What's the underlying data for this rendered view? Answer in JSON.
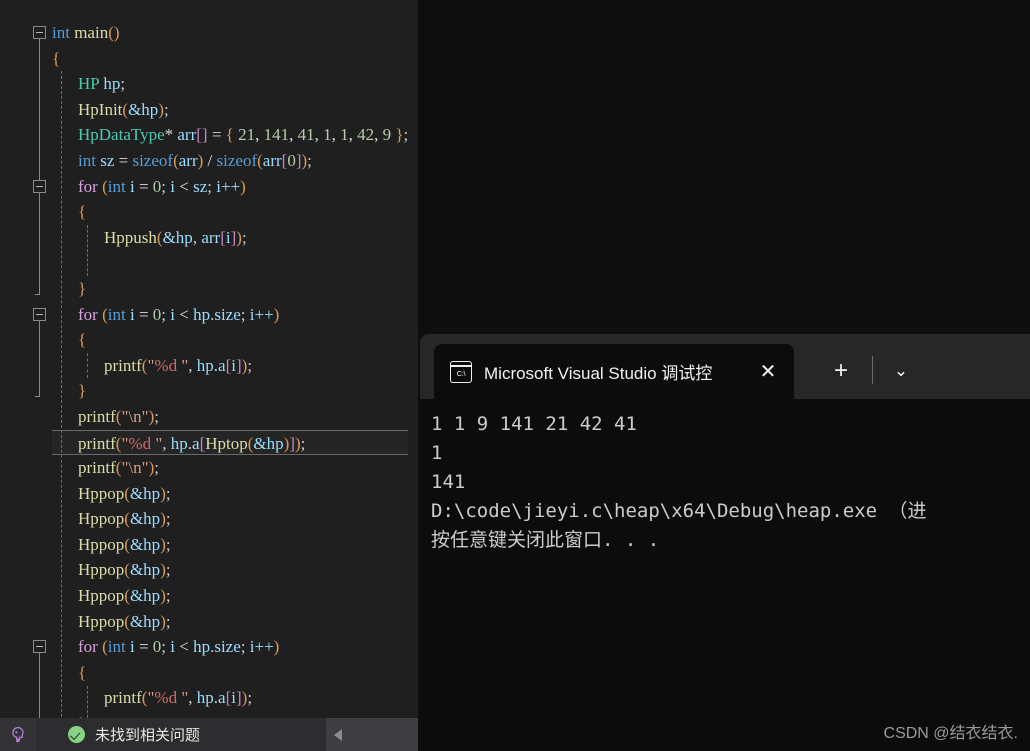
{
  "editor": {
    "name": "visual-studio-code-editor",
    "language": "C",
    "lines": [
      {
        "indent": 0,
        "tokens": [
          {
            "t": "int",
            "c": "tk-kw"
          },
          {
            "t": " ",
            "c": "tk-plain"
          },
          {
            "t": "main",
            "c": "tk-fn"
          },
          {
            "t": "()",
            "c": "tk-brace"
          }
        ]
      },
      {
        "indent": 0,
        "tokens": [
          {
            "t": "{",
            "c": "tk-brace"
          }
        ]
      },
      {
        "indent": 1,
        "tokens": [
          {
            "t": "HP",
            "c": "tk-type"
          },
          {
            "t": " ",
            "c": "tk-plain"
          },
          {
            "t": "hp",
            "c": "tk-var"
          },
          {
            "t": ";",
            "c": "tk-punc"
          }
        ]
      },
      {
        "indent": 1,
        "tokens": [
          {
            "t": "HpInit",
            "c": "tk-fn"
          },
          {
            "t": "(",
            "c": "tk-brace"
          },
          {
            "t": "&hp",
            "c": "tk-var"
          },
          {
            "t": ")",
            "c": "tk-brace"
          },
          {
            "t": ";",
            "c": "tk-punc"
          }
        ]
      },
      {
        "indent": 1,
        "tokens": [
          {
            "t": "HpDataType",
            "c": "tk-type"
          },
          {
            "t": "* ",
            "c": "tk-plain"
          },
          {
            "t": "arr",
            "c": "tk-var"
          },
          {
            "t": "[]",
            "c": "tk-brkt"
          },
          {
            "t": " = ",
            "c": "tk-plain"
          },
          {
            "t": "{",
            "c": "tk-brace"
          },
          {
            "t": " ",
            "c": "tk-plain"
          },
          {
            "t": "21",
            "c": "tk-num"
          },
          {
            "t": ", ",
            "c": "tk-plain"
          },
          {
            "t": "141",
            "c": "tk-num"
          },
          {
            "t": ", ",
            "c": "tk-plain"
          },
          {
            "t": "41",
            "c": "tk-num"
          },
          {
            "t": ", ",
            "c": "tk-plain"
          },
          {
            "t": "1",
            "c": "tk-num"
          },
          {
            "t": ", ",
            "c": "tk-plain"
          },
          {
            "t": "1",
            "c": "tk-num"
          },
          {
            "t": ", ",
            "c": "tk-plain"
          },
          {
            "t": "42",
            "c": "tk-num"
          },
          {
            "t": ", ",
            "c": "tk-plain"
          },
          {
            "t": "9",
            "c": "tk-num"
          },
          {
            "t": " ",
            "c": "tk-plain"
          },
          {
            "t": "}",
            "c": "tk-brace"
          },
          {
            "t": ";",
            "c": "tk-punc"
          }
        ]
      },
      {
        "indent": 1,
        "tokens": [
          {
            "t": "int",
            "c": "tk-kw"
          },
          {
            "t": " ",
            "c": "tk-plain"
          },
          {
            "t": "sz",
            "c": "tk-var"
          },
          {
            "t": " = ",
            "c": "tk-plain"
          },
          {
            "t": "sizeof",
            "c": "tk-kw"
          },
          {
            "t": "(",
            "c": "tk-brace"
          },
          {
            "t": "arr",
            "c": "tk-var"
          },
          {
            "t": ")",
            "c": "tk-brace"
          },
          {
            "t": " / ",
            "c": "tk-plain"
          },
          {
            "t": "sizeof",
            "c": "tk-kw"
          },
          {
            "t": "(",
            "c": "tk-brace"
          },
          {
            "t": "arr",
            "c": "tk-var"
          },
          {
            "t": "[",
            "c": "tk-brkt"
          },
          {
            "t": "0",
            "c": "tk-num"
          },
          {
            "t": "]",
            "c": "tk-brkt"
          },
          {
            "t": ")",
            "c": "tk-brace"
          },
          {
            "t": ";",
            "c": "tk-punc"
          }
        ]
      },
      {
        "indent": 1,
        "tokens": [
          {
            "t": "for",
            "c": "tk-ctl"
          },
          {
            "t": " ",
            "c": "tk-plain"
          },
          {
            "t": "(",
            "c": "tk-brace"
          },
          {
            "t": "int",
            "c": "tk-kw"
          },
          {
            "t": " ",
            "c": "tk-plain"
          },
          {
            "t": "i",
            "c": "tk-var"
          },
          {
            "t": " = ",
            "c": "tk-plain"
          },
          {
            "t": "0",
            "c": "tk-num"
          },
          {
            "t": "; ",
            "c": "tk-punc"
          },
          {
            "t": "i",
            "c": "tk-var"
          },
          {
            "t": " < ",
            "c": "tk-plain"
          },
          {
            "t": "sz",
            "c": "tk-var"
          },
          {
            "t": "; ",
            "c": "tk-punc"
          },
          {
            "t": "i++",
            "c": "tk-var"
          },
          {
            "t": ")",
            "c": "tk-brace"
          }
        ]
      },
      {
        "indent": 1,
        "tokens": [
          {
            "t": "{",
            "c": "tk-brace"
          }
        ]
      },
      {
        "indent": 2,
        "tokens": [
          {
            "t": "Hppush",
            "c": "tk-fn"
          },
          {
            "t": "(",
            "c": "tk-brace"
          },
          {
            "t": "&hp",
            "c": "tk-var"
          },
          {
            "t": ", ",
            "c": "tk-punc"
          },
          {
            "t": "arr",
            "c": "tk-var"
          },
          {
            "t": "[",
            "c": "tk-brkt"
          },
          {
            "t": "i",
            "c": "tk-var"
          },
          {
            "t": "]",
            "c": "tk-brkt"
          },
          {
            "t": ")",
            "c": "tk-brace"
          },
          {
            "t": ";",
            "c": "tk-punc"
          }
        ]
      },
      {
        "indent": 2,
        "tokens": []
      },
      {
        "indent": 1,
        "tokens": [
          {
            "t": "}",
            "c": "tk-brace"
          }
        ]
      },
      {
        "indent": 1,
        "tokens": [
          {
            "t": "for",
            "c": "tk-ctl"
          },
          {
            "t": " ",
            "c": "tk-plain"
          },
          {
            "t": "(",
            "c": "tk-brace"
          },
          {
            "t": "int",
            "c": "tk-kw"
          },
          {
            "t": " ",
            "c": "tk-plain"
          },
          {
            "t": "i",
            "c": "tk-var"
          },
          {
            "t": " = ",
            "c": "tk-plain"
          },
          {
            "t": "0",
            "c": "tk-num"
          },
          {
            "t": "; ",
            "c": "tk-punc"
          },
          {
            "t": "i",
            "c": "tk-var"
          },
          {
            "t": " < ",
            "c": "tk-plain"
          },
          {
            "t": "hp",
            "c": "tk-var"
          },
          {
            "t": ".",
            "c": "tk-punc"
          },
          {
            "t": "size",
            "c": "tk-var"
          },
          {
            "t": "; ",
            "c": "tk-punc"
          },
          {
            "t": "i++",
            "c": "tk-var"
          },
          {
            "t": ")",
            "c": "tk-brace"
          }
        ]
      },
      {
        "indent": 1,
        "tokens": [
          {
            "t": "{",
            "c": "tk-brace"
          }
        ]
      },
      {
        "indent": 2,
        "tokens": [
          {
            "t": "printf",
            "c": "tk-fn"
          },
          {
            "t": "(",
            "c": "tk-brace"
          },
          {
            "t": "\"",
            "c": "tk-str"
          },
          {
            "t": "%d",
            "c": "tk-fmt"
          },
          {
            "t": " \"",
            "c": "tk-str"
          },
          {
            "t": ", ",
            "c": "tk-punc"
          },
          {
            "t": "hp",
            "c": "tk-var"
          },
          {
            "t": ".",
            "c": "tk-punc"
          },
          {
            "t": "a",
            "c": "tk-var"
          },
          {
            "t": "[",
            "c": "tk-brkt"
          },
          {
            "t": "i",
            "c": "tk-var"
          },
          {
            "t": "]",
            "c": "tk-brkt"
          },
          {
            "t": ")",
            "c": "tk-brace"
          },
          {
            "t": ";",
            "c": "tk-punc"
          }
        ]
      },
      {
        "indent": 1,
        "tokens": [
          {
            "t": "}",
            "c": "tk-brace"
          }
        ]
      },
      {
        "indent": 1,
        "tokens": [
          {
            "t": "printf",
            "c": "tk-fn"
          },
          {
            "t": "(",
            "c": "tk-brace"
          },
          {
            "t": "\"\\n\"",
            "c": "tk-str"
          },
          {
            "t": ")",
            "c": "tk-brace"
          },
          {
            "t": ";",
            "c": "tk-punc"
          }
        ]
      },
      {
        "indent": 1,
        "current": true,
        "tokens": [
          {
            "t": "printf",
            "c": "tk-fn"
          },
          {
            "t": "(",
            "c": "tk-brace"
          },
          {
            "t": "\"",
            "c": "tk-str"
          },
          {
            "t": "%d",
            "c": "tk-fmt"
          },
          {
            "t": " \"",
            "c": "tk-str"
          },
          {
            "t": ", ",
            "c": "tk-punc"
          },
          {
            "t": "hp",
            "c": "tk-var"
          },
          {
            "t": ".",
            "c": "tk-punc"
          },
          {
            "t": "a",
            "c": "tk-var"
          },
          {
            "t": "[",
            "c": "tk-brkt"
          },
          {
            "t": "Hptop",
            "c": "tk-fn"
          },
          {
            "t": "(",
            "c": "tk-brace"
          },
          {
            "t": "&hp",
            "c": "tk-var"
          },
          {
            "t": ")",
            "c": "tk-brace"
          },
          {
            "t": "]",
            "c": "tk-brkt"
          },
          {
            "t": ")",
            "c": "tk-brace"
          },
          {
            "t": ";",
            "c": "tk-punc"
          }
        ]
      },
      {
        "indent": 1,
        "tokens": [
          {
            "t": "printf",
            "c": "tk-fn"
          },
          {
            "t": "(",
            "c": "tk-brace"
          },
          {
            "t": "\"\\n\"",
            "c": "tk-str"
          },
          {
            "t": ")",
            "c": "tk-brace"
          },
          {
            "t": ";",
            "c": "tk-punc"
          }
        ]
      },
      {
        "indent": 1,
        "tokens": [
          {
            "t": "Hppop",
            "c": "tk-fn"
          },
          {
            "t": "(",
            "c": "tk-brace"
          },
          {
            "t": "&hp",
            "c": "tk-var"
          },
          {
            "t": ")",
            "c": "tk-brace"
          },
          {
            "t": ";",
            "c": "tk-punc"
          }
        ]
      },
      {
        "indent": 1,
        "tokens": [
          {
            "t": "Hppop",
            "c": "tk-fn"
          },
          {
            "t": "(",
            "c": "tk-brace"
          },
          {
            "t": "&hp",
            "c": "tk-var"
          },
          {
            "t": ")",
            "c": "tk-brace"
          },
          {
            "t": ";",
            "c": "tk-punc"
          }
        ]
      },
      {
        "indent": 1,
        "tokens": [
          {
            "t": "Hppop",
            "c": "tk-fn"
          },
          {
            "t": "(",
            "c": "tk-brace"
          },
          {
            "t": "&hp",
            "c": "tk-var"
          },
          {
            "t": ")",
            "c": "tk-brace"
          },
          {
            "t": ";",
            "c": "tk-punc"
          }
        ]
      },
      {
        "indent": 1,
        "tokens": [
          {
            "t": "Hppop",
            "c": "tk-fn"
          },
          {
            "t": "(",
            "c": "tk-brace"
          },
          {
            "t": "&hp",
            "c": "tk-var"
          },
          {
            "t": ")",
            "c": "tk-brace"
          },
          {
            "t": ";",
            "c": "tk-punc"
          }
        ]
      },
      {
        "indent": 1,
        "tokens": [
          {
            "t": "Hppop",
            "c": "tk-fn"
          },
          {
            "t": "(",
            "c": "tk-brace"
          },
          {
            "t": "&hp",
            "c": "tk-var"
          },
          {
            "t": ")",
            "c": "tk-brace"
          },
          {
            "t": ";",
            "c": "tk-punc"
          }
        ]
      },
      {
        "indent": 1,
        "tokens": [
          {
            "t": "Hppop",
            "c": "tk-fn"
          },
          {
            "t": "(",
            "c": "tk-brace"
          },
          {
            "t": "&hp",
            "c": "tk-var"
          },
          {
            "t": ")",
            "c": "tk-brace"
          },
          {
            "t": ";",
            "c": "tk-punc"
          }
        ]
      },
      {
        "indent": 1,
        "tokens": [
          {
            "t": "for",
            "c": "tk-ctl"
          },
          {
            "t": " ",
            "c": "tk-plain"
          },
          {
            "t": "(",
            "c": "tk-brace"
          },
          {
            "t": "int",
            "c": "tk-kw"
          },
          {
            "t": " ",
            "c": "tk-plain"
          },
          {
            "t": "i",
            "c": "tk-var"
          },
          {
            "t": " = ",
            "c": "tk-plain"
          },
          {
            "t": "0",
            "c": "tk-num"
          },
          {
            "t": "; ",
            "c": "tk-punc"
          },
          {
            "t": "i",
            "c": "tk-var"
          },
          {
            "t": " < ",
            "c": "tk-plain"
          },
          {
            "t": "hp",
            "c": "tk-var"
          },
          {
            "t": ".",
            "c": "tk-punc"
          },
          {
            "t": "size",
            "c": "tk-var"
          },
          {
            "t": "; ",
            "c": "tk-punc"
          },
          {
            "t": "i++",
            "c": "tk-var"
          },
          {
            "t": ")",
            "c": "tk-brace"
          }
        ]
      },
      {
        "indent": 1,
        "tokens": [
          {
            "t": "{",
            "c": "tk-brace"
          }
        ]
      },
      {
        "indent": 2,
        "tokens": [
          {
            "t": "printf",
            "c": "tk-fn"
          },
          {
            "t": "(",
            "c": "tk-brace"
          },
          {
            "t": "\"",
            "c": "tk-str"
          },
          {
            "t": "%d",
            "c": "tk-fmt"
          },
          {
            "t": " \"",
            "c": "tk-str"
          },
          {
            "t": ", ",
            "c": "tk-punc"
          },
          {
            "t": "hp",
            "c": "tk-var"
          },
          {
            "t": ".",
            "c": "tk-punc"
          },
          {
            "t": "a",
            "c": "tk-var"
          },
          {
            "t": "[",
            "c": "tk-brkt"
          },
          {
            "t": "i",
            "c": "tk-var"
          },
          {
            "t": "]",
            "c": "tk-brkt"
          },
          {
            "t": ")",
            "c": "tk-brace"
          },
          {
            "t": ";",
            "c": "tk-punc"
          }
        ]
      },
      {
        "indent": 1,
        "tokens": [
          {
            "t": "}",
            "c": "tk-brace"
          }
        ]
      }
    ],
    "fold_markers": [
      {
        "line": 0,
        "rail_lines": 6
      },
      {
        "line": 6,
        "rail_lines": 4
      },
      {
        "line": 11,
        "rail_lines": 3
      },
      {
        "line": 24,
        "rail_lines": 3
      }
    ],
    "indent_guides": [
      {
        "x": 61,
        "from_line": 2,
        "to_line": 27
      },
      {
        "x": 87,
        "from_line": 8,
        "to_line": 9
      },
      {
        "x": 87,
        "from_line": 13,
        "to_line": 13
      },
      {
        "x": 87,
        "from_line": 26,
        "to_line": 27
      }
    ]
  },
  "terminal": {
    "tab": {
      "title": "Microsoft Visual Studio 调试控",
      "icon": "console-icon",
      "icon_label": "C:\\",
      "close_label": "✕"
    },
    "new_tab_label": "+",
    "dropdown_label": "⌄",
    "output_lines": [
      "1 1 9 141 21 42 41",
      "1",
      "141",
      "D:\\code\\jieyi.c\\heap\\x64\\Debug\\heap.exe （进",
      "按任意键关闭此窗口. . ."
    ]
  },
  "status_bar": {
    "copilot_icon": "copilot-icon",
    "check_icon": "check-circle-icon",
    "message": "未找到相关问题",
    "scroll_arrow": "left-arrow-icon"
  },
  "watermark": {
    "text": "CSDN @结衣结衣."
  }
}
